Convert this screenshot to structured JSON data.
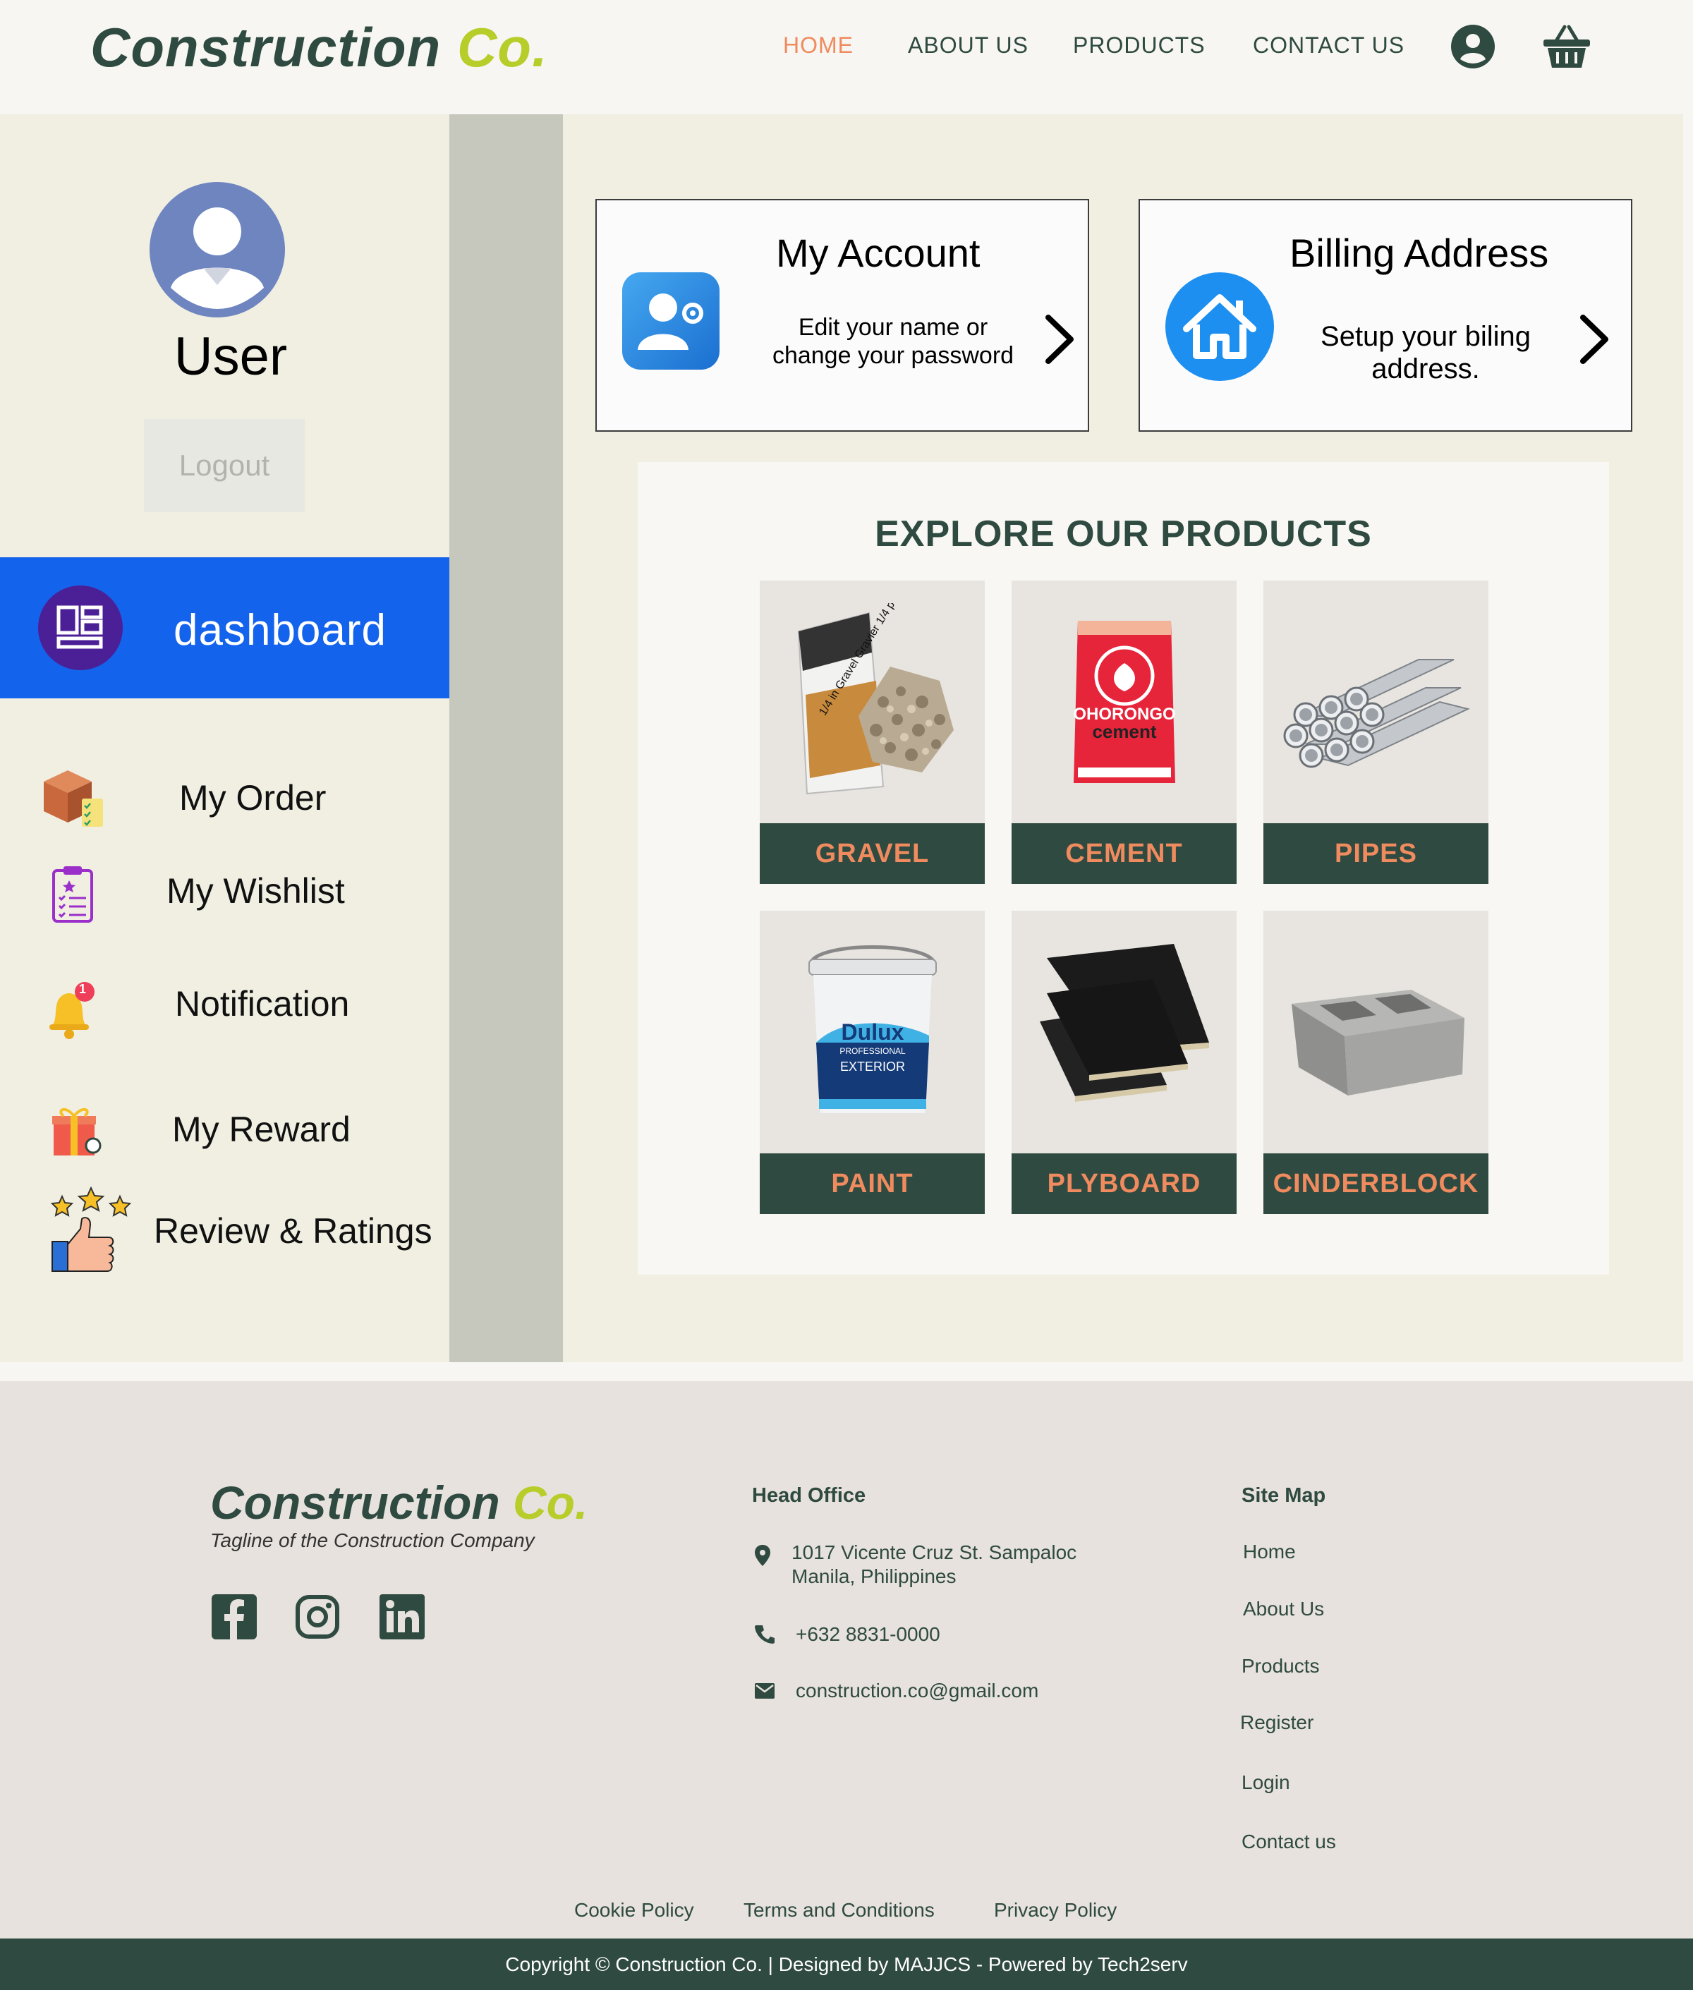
{
  "header": {
    "logo_main": "Construction",
    "logo_co": "Co.",
    "nav": [
      "HOME",
      "ABOUT US",
      "PRODUCTS",
      "CONTACT US"
    ],
    "active_nav": "HOME"
  },
  "sidebar": {
    "user_name": "User",
    "logout_label": "Logout",
    "dashboard_label": "dashboard",
    "items": [
      {
        "label": "My Order",
        "icon": "box-checklist-icon"
      },
      {
        "label": "My Wishlist",
        "icon": "wishlist-clipboard-icon"
      },
      {
        "label": "Notification",
        "icon": "bell-icon",
        "badge": "1"
      },
      {
        "label": "My Reward",
        "icon": "gift-icon"
      },
      {
        "label": "Review & Ratings",
        "icon": "thumbs-up-stars-icon"
      }
    ]
  },
  "cards": {
    "account": {
      "title": "My Account",
      "line1": "Edit your name or",
      "line2": "change your password"
    },
    "billing": {
      "title": "Billing Address",
      "line1": "Setup your biling",
      "line2": "address."
    }
  },
  "products": {
    "title": "EXPLORE OUR PRODUCTS",
    "items": [
      "GRAVEL",
      "CEMENT",
      "PIPES",
      "PAINT",
      "PLYBOARD",
      "CINDERBLOCK"
    ],
    "gravel_bag_text": "1/4 in Gravel Gravier 1/4 po",
    "cement_brand": "OHORONGO",
    "cement_word": "cement",
    "paint_brand": "Dulux",
    "paint_line1": "PROFESSIONAL",
    "paint_line2": "EXTERIOR"
  },
  "footer": {
    "logo_main": "Construction",
    "logo_co": "Co.",
    "tagline": "Tagline of the Construction Company",
    "head_office_title": "Head Office",
    "address_line1": "1017 Vicente Cruz St. Sampaloc",
    "address_line2": "Manila, Philippines",
    "phone": "+632 8831-0000",
    "email": "construction.co@gmail.com",
    "sitemap_title": "Site Map",
    "sitemap": [
      "Home",
      "About Us",
      "Products",
      "Register",
      "Login",
      "Contact us"
    ],
    "policies": [
      "Cookie Policy",
      "Terms and Conditions",
      "Privacy Policy"
    ],
    "copyright": "Copyright © Construction Co.  | Designed by MAJJCS - Powered by Tech2serv"
  },
  "colors": {
    "brand_dark": "#2f4a40",
    "brand_lime": "#b7cd2a",
    "accent_orange": "#ef8b5e",
    "dashboard_blue": "#1463ec"
  }
}
